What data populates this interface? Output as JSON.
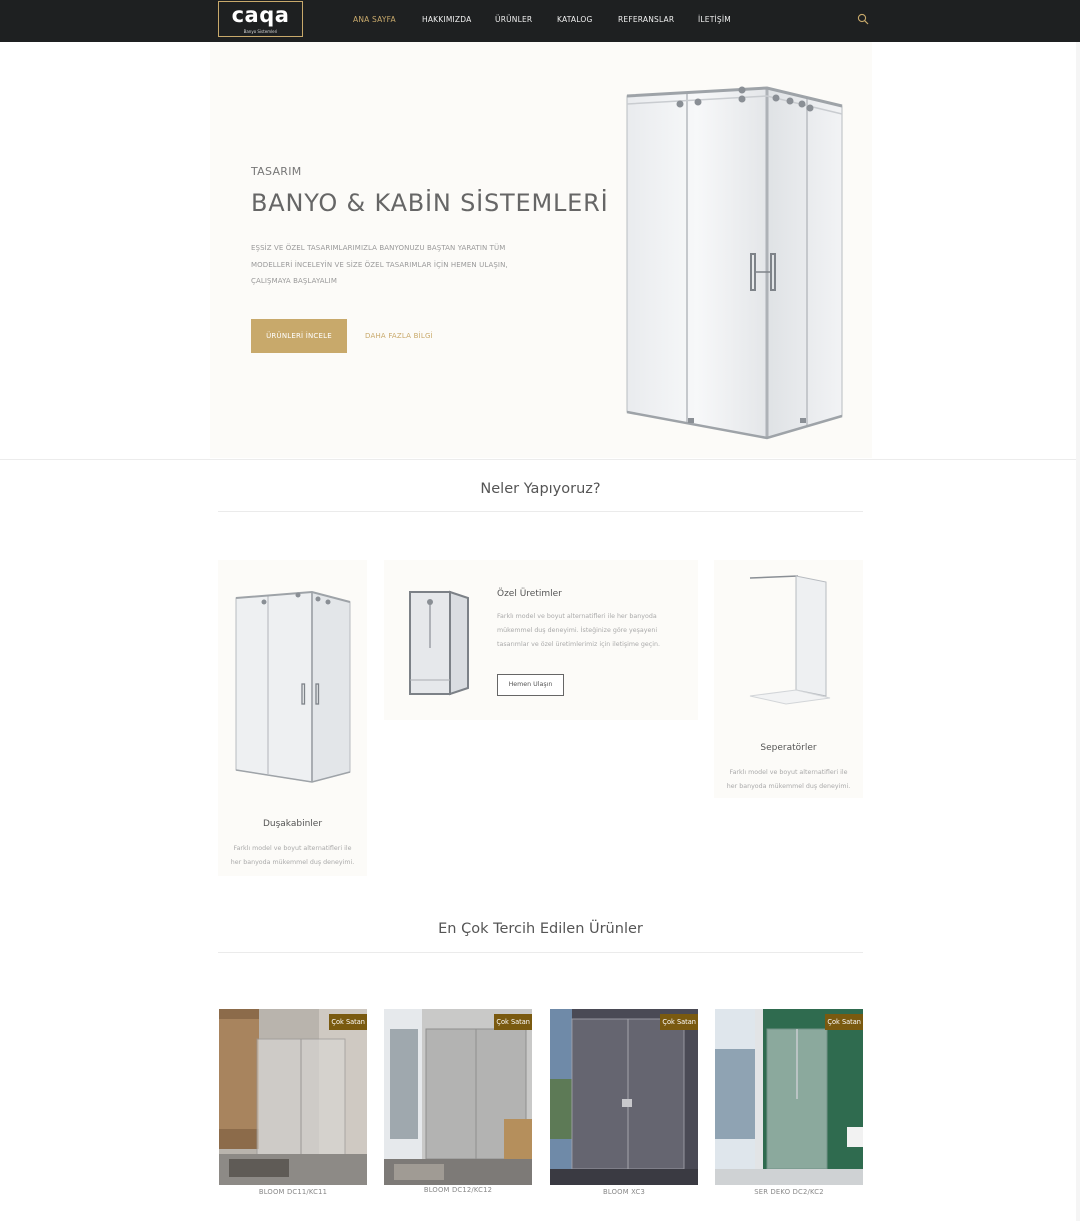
{
  "brand": {
    "name": "caqa",
    "tagline": "Banyo Sistemleri"
  },
  "nav": {
    "items": [
      {
        "label": "ANA SAYFA",
        "active": true
      },
      {
        "label": "HAKKIMIZDA",
        "active": false
      },
      {
        "label": "ÜRÜNLER",
        "active": false
      },
      {
        "label": "KATALOG",
        "active": false
      },
      {
        "label": "REFERANSLAR",
        "active": false
      },
      {
        "label": "İLETİŞİM",
        "active": false
      }
    ],
    "search_icon": "search-icon"
  },
  "hero": {
    "eyebrow": "TASARIM",
    "title": "BANYO & KABİN SİSTEMLERİ",
    "text": "EŞSİZ VE ÖZEL TASARIMLARIMIZLA BANYONUZU BAŞTAN YARATIN TÜM MODELLERİ İNCELEYİN VE SİZE ÖZEL TASARIMLAR İÇİN HEMEN ULAŞIN, ÇALIŞMAYA BAŞLAYALIM",
    "primary_button": "ÜRÜNLERİ İNCELE",
    "secondary_link": "DAHA FAZLA BİLGİ"
  },
  "services": {
    "title": "Neler Yapıyoruz?",
    "cards": [
      {
        "title": "Duşakabinler",
        "text": "Farklı model ve boyut alternatifleri ile her banyoda mükemmel duş deneyimi."
      },
      {
        "title": "Özel Üretimler",
        "text": "Farklı model ve boyut alternatifleri ile her banyoda mükemmel duş deneyimi. İsteğinize göre yeşayeni tasarımlar ve özel üretimlerimiz için iletişime geçin.",
        "button": "Hemen Ulaşın"
      },
      {
        "title": "Seperatörler",
        "text": "Farklı model ve boyut alternatifleri ile her banyoda mükemmel duş deneyimi."
      }
    ]
  },
  "products": {
    "title": "En Çok Tercih Edilen Ürünler",
    "badge": "Çok Satan",
    "items": [
      {
        "name": "BLOOM DC11/KC11"
      },
      {
        "name": "BLOOM DC12/KC12"
      },
      {
        "name": "BLOOM XC3"
      },
      {
        "name": "SER DEKO DC2/KC2"
      }
    ]
  },
  "colors": {
    "accent": "#c8a96b",
    "nav_bg": "#1e2021",
    "badge_bg": "#7a5a10",
    "hero_bg": "#fcfbf8"
  }
}
